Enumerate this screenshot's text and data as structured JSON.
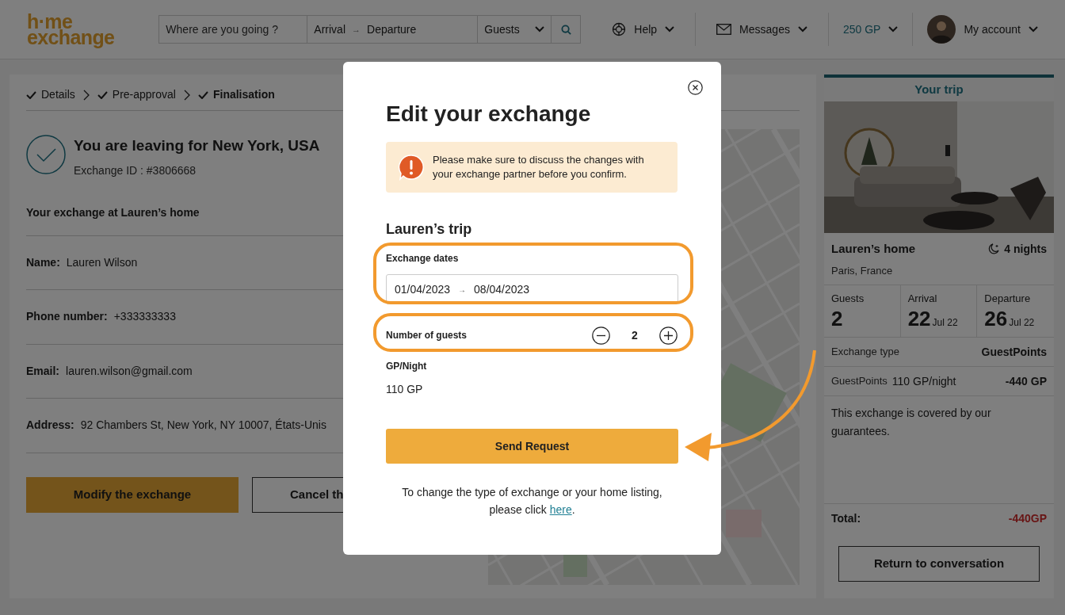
{
  "header": {
    "logo": {
      "line_1": "h·me",
      "line_2": "exchange"
    },
    "search": {
      "destination_placeholder": "Where are you going ?",
      "arrival": "Arrival",
      "arrow": "→",
      "departure": "Departure",
      "guests": "Guests"
    },
    "nav": [
      {
        "label": "Help",
        "kind": "help"
      },
      {
        "label": "Messages",
        "kind": "messages"
      },
      {
        "label": "250 GP",
        "kind": "points"
      },
      {
        "label": "My account",
        "kind": "account"
      }
    ]
  },
  "breadcrumb": [
    {
      "label": "Details",
      "done": true,
      "selected": false
    },
    {
      "label": "Pre-approval",
      "done": true,
      "selected": false
    },
    {
      "label": "Finalisation",
      "done": true,
      "selected": true
    }
  ],
  "summary": {
    "title": "You are leaving for New York, USA",
    "exchange_id": "Exchange ID : #3806668"
  },
  "section_title": "Your exchange at Lauren’s home",
  "fields": [
    {
      "label": "Name:",
      "value": "Lauren Wilson"
    },
    {
      "label": "Phone number:",
      "value": "+333333333"
    },
    {
      "label": "Email:",
      "value": "lauren.wilson@gmail.com"
    },
    {
      "label": "Address:",
      "value": "92 Chambers St, New York, NY 10007, États-Unis"
    }
  ],
  "buttons": [
    {
      "label": "Modify the exchange",
      "kind": "primary"
    },
    {
      "label": "Cancel th",
      "kind": "secondary"
    }
  ],
  "trip": {
    "title": "Your trip",
    "home": "Lauren’s home",
    "location": "Paris, France",
    "nights": "4 nights",
    "stats": [
      {
        "label": "Guests",
        "value": "2"
      },
      {
        "label": "Arrival",
        "value": "22",
        "suffix": "Jul 22"
      },
      {
        "label": "Departure",
        "value": "26",
        "suffix": "Jul 22"
      }
    ],
    "exchange_type_label": "Exchange type",
    "exchange_type": "GuestPoints",
    "points_label": "GuestPoints",
    "rate": "110 GP/night",
    "points": "-440 GP",
    "guarantee": "This exchange is covered by our guarantees.",
    "total_label": "Total:",
    "total": "-440GP",
    "return_button": "Return to conversation"
  },
  "modal": {
    "title": "Edit your exchange",
    "alert": "Please make sure to discuss the changes with your exchange partner before you confirm.",
    "section": "Lauren’s trip",
    "dates_label": "Exchange dates",
    "arrival": "01/04/2023",
    "arrow": "→",
    "departure": "08/04/2023",
    "guests_label": "Number of guests",
    "guests": "2",
    "rate_label": "GP/Night",
    "rate": "110 GP",
    "submit": "Send Request",
    "footer": "To change the type of exchange or your home listing, please click ",
    "link": "here",
    "footer_end": "."
  }
}
